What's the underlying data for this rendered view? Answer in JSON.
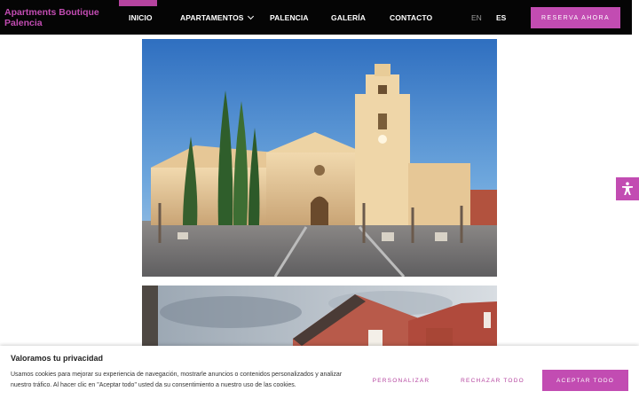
{
  "header": {
    "brand": "Apartments Boutique Palencia",
    "nav": [
      {
        "label": "INICIO",
        "active": true
      },
      {
        "label": "APARTAMENTOS",
        "has_dropdown": true
      },
      {
        "label": "PALENCIA"
      },
      {
        "label": "GALERÍA"
      },
      {
        "label": "CONTACTO"
      }
    ],
    "languages": [
      {
        "code": "EN",
        "active": false
      },
      {
        "code": "ES",
        "active": true
      }
    ],
    "reserve_label": "RESERVA AHORA"
  },
  "accessibility": {
    "icon": "accessibility-icon"
  },
  "cookie": {
    "title": "Valoramos tu privacidad",
    "text": "Usamos cookies para mejorar su experiencia de navegación, mostrarle anuncios o contenidos personalizados y analizar nuestro tráfico. Al hacer clic en \"Aceptar todo\" usted da su consentimiento a nuestro uso de las cookies.",
    "personalize_label": "PERSONALIZAR",
    "reject_label": "RECHAZAR TODO",
    "accept_label": "ACEPTAR TODO"
  },
  "colors": {
    "brand": "#c24cb2",
    "header_bg": "#050505",
    "text_dark": "#222222"
  }
}
